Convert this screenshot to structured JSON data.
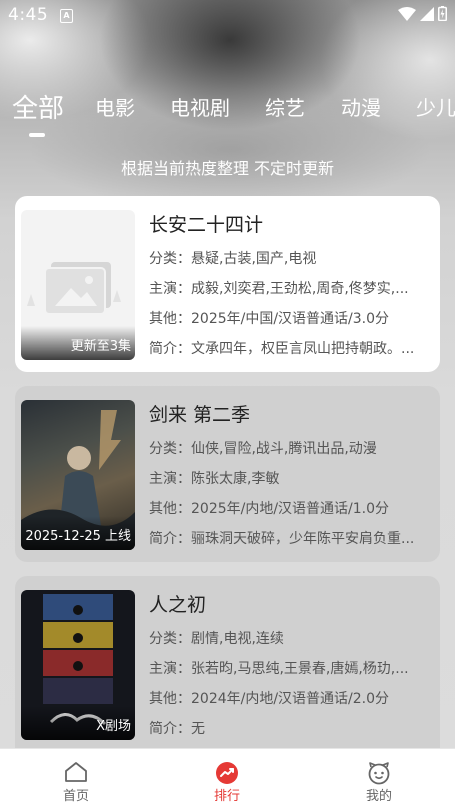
{
  "status": {
    "time": "4:45",
    "notif_letter": "A"
  },
  "tabs": [
    {
      "label": "全部",
      "active": true
    },
    {
      "label": "电影"
    },
    {
      "label": "电视剧"
    },
    {
      "label": "综艺"
    },
    {
      "label": "动漫"
    },
    {
      "label": "少儿"
    }
  ],
  "subtitle": "根据当前热度整理 不定时更新",
  "items": [
    {
      "title": "长安二十四计",
      "category": "分类：悬疑,古装,国产,电视",
      "cast": "主演：成毅,刘奕君,王劲松,周奇,佟梦实,...",
      "other": "其他：2025年/中国/汉语普通话/3.0分",
      "intro": "简介：文承四年，权臣言凤山把持朝政。...",
      "badge": "更新至3集",
      "poster": "placeholder-image-icon"
    },
    {
      "title": "剑来 第二季",
      "category": "分类：仙侠,冒险,战斗,腾讯出品,动漫",
      "cast": "主演：陈张太康,李敏",
      "other": "其他：2025年/内地/汉语普通话/1.0分",
      "intro": "简介：骊珠洞天破碎，少年陈平安肩负重...",
      "badge": "2025-12-25 上线",
      "poster": "poster-jianlai"
    },
    {
      "title": "人之初",
      "category": "分类：剧情,电视,连续",
      "cast": "主演：张若昀,马思纯,王景春,唐嫣,杨玏,...",
      "other": "其他：2024年/内地/汉语普通话/2.0分",
      "intro": "简介：无",
      "badge": "X剧场",
      "poster": "poster-renzhichu"
    }
  ],
  "nav": [
    {
      "label": "首页",
      "icon": "home-icon"
    },
    {
      "label": "排行",
      "icon": "trending-icon",
      "active": true
    },
    {
      "label": "我的",
      "icon": "face-icon"
    }
  ],
  "colors": {
    "accent": "#e53935"
  }
}
